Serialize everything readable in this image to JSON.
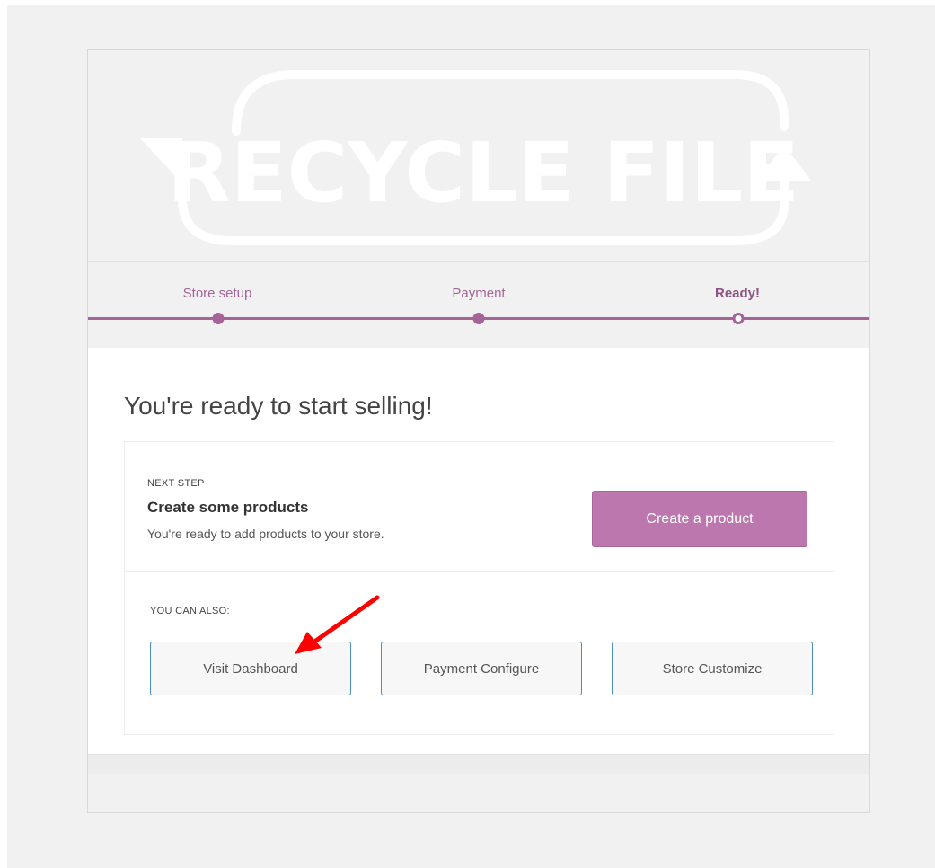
{
  "logo": {
    "text": "RECYCLE FILE"
  },
  "steps": [
    {
      "label": "Store setup",
      "state": "done"
    },
    {
      "label": "Payment",
      "state": "done"
    },
    {
      "label": "Ready!",
      "state": "current"
    }
  ],
  "main": {
    "headline": "You're ready to start selling!",
    "next_step": {
      "kicker": "NEXT STEP",
      "title": "Create some products",
      "description": "You're ready to add products to your store.",
      "button_label": "Create a product"
    },
    "also": {
      "kicker": "YOU CAN ALSO:",
      "buttons": [
        {
          "label": "Visit Dashboard"
        },
        {
          "label": "Payment Configure"
        },
        {
          "label": "Store Customize"
        }
      ]
    }
  },
  "colors": {
    "accent": "#a46497",
    "primary_button": "#bb77ae",
    "secondary_button_border": "#4a8fc0",
    "annotation_arrow": "#ff0000"
  }
}
